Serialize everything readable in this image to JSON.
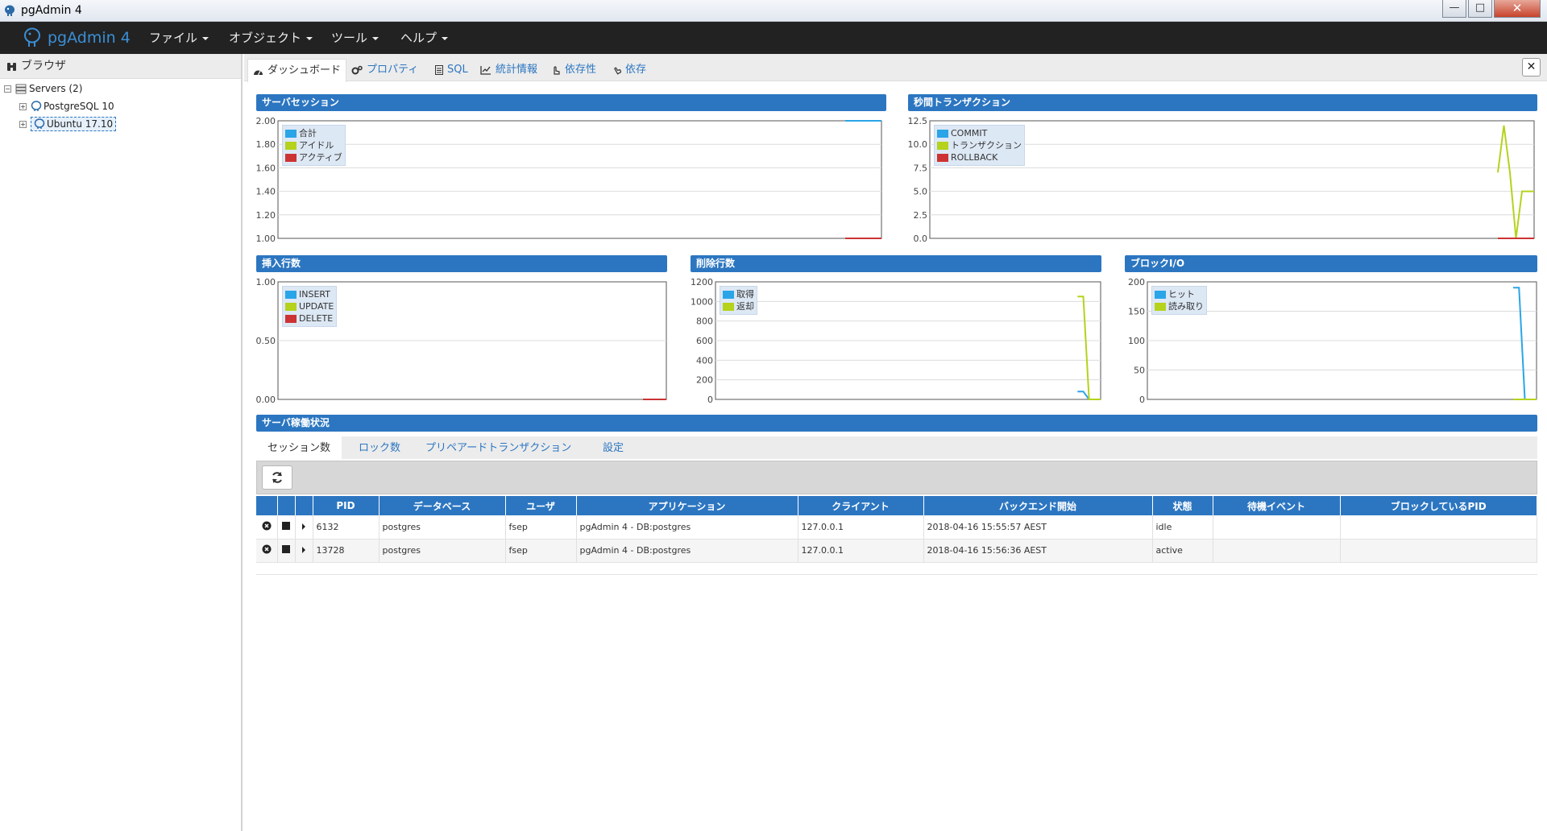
{
  "window": {
    "title": "pgAdmin 4",
    "controls": {
      "minimize": "—",
      "maximize": "□",
      "close": "✕"
    }
  },
  "appbar": {
    "brand": "pgAdmin 4",
    "menus": [
      "ファイル",
      "オブジェクト",
      "ツール",
      "ヘルプ"
    ]
  },
  "browser": {
    "title": "ブラウザ",
    "tree": {
      "servers_label": "Servers (2)",
      "children": [
        "PostgreSQL 10",
        "Ubuntu 17.10"
      ]
    }
  },
  "tabs": [
    "ダッシュボード",
    "プロパティ",
    "SQL",
    "統計情報",
    "依存性",
    "依存"
  ],
  "panels": {
    "server_sessions": "サーバセッション",
    "tps": "秒間トランザクション",
    "tuples_in": "挿入行数",
    "tuples_out": "削除行数",
    "block_io": "ブロックI/O",
    "server_activity": "サーバ稼働状況"
  },
  "chart_data": [
    {
      "type": "line",
      "title": "サーバセッション",
      "ylim": [
        1.0,
        2.0
      ],
      "yticks": [
        "2.00",
        "1.80",
        "1.60",
        "1.40",
        "1.20",
        "1.00"
      ],
      "legend_placement": "top-left",
      "grid": true,
      "series": [
        {
          "name": "合計",
          "color": "#2aa5e8",
          "values": [
            2,
            2,
            2,
            2,
            2,
            2,
            2,
            2
          ]
        },
        {
          "name": "アイドル",
          "color": "#b5d21c",
          "values": [
            1,
            1,
            1,
            1,
            1,
            1,
            1,
            1
          ]
        },
        {
          "name": "アクティブ",
          "color": "#cc3333",
          "values": [
            1,
            1,
            1,
            1,
            1,
            1,
            1,
            1
          ]
        }
      ]
    },
    {
      "type": "line",
      "title": "秒間トランザクション",
      "ylim": [
        0,
        12.5
      ],
      "yticks": [
        "12.5",
        "10.0",
        "7.5",
        "5.0",
        "2.5",
        "0.0"
      ],
      "legend_placement": "top-left",
      "grid": true,
      "series": [
        {
          "name": "COMMIT",
          "color": "#2aa5e8",
          "values": [
            0,
            0,
            0,
            0,
            0,
            0,
            0
          ]
        },
        {
          "name": "トランザクション",
          "color": "#b5d21c",
          "values": [
            7,
            12,
            7,
            0,
            5,
            5,
            5
          ]
        },
        {
          "name": "ROLLBACK",
          "color": "#cc3333",
          "values": [
            0,
            0,
            0,
            0,
            0,
            0,
            0
          ]
        }
      ]
    },
    {
      "type": "line",
      "title": "挿入行数",
      "ylim": [
        0,
        1.0
      ],
      "yticks": [
        "1.00",
        "0.50",
        "0.00"
      ],
      "legend_placement": "top-left",
      "grid": true,
      "series": [
        {
          "name": "INSERT",
          "color": "#2aa5e8",
          "values": [
            0,
            0,
            0,
            0
          ]
        },
        {
          "name": "UPDATE",
          "color": "#b5d21c",
          "values": [
            0,
            0,
            0,
            0
          ]
        },
        {
          "name": "DELETE",
          "color": "#cc3333",
          "values": [
            0,
            0,
            0,
            0
          ]
        }
      ]
    },
    {
      "type": "line",
      "title": "削除行数",
      "ylim": [
        0,
        1200
      ],
      "yticks": [
        "1200",
        "1000",
        "800",
        "600",
        "400",
        "200",
        "0"
      ],
      "legend_placement": "top-left",
      "grid": true,
      "series": [
        {
          "name": "取得",
          "color": "#2aa5e8",
          "values": [
            80,
            80,
            0,
            0,
            0
          ]
        },
        {
          "name": "返却",
          "color": "#b5d21c",
          "values": [
            1050,
            1050,
            0,
            0,
            0
          ]
        }
      ]
    },
    {
      "type": "line",
      "title": "ブロックI/O",
      "ylim": [
        0,
        200
      ],
      "yticks": [
        "200",
        "150",
        "100",
        "50",
        "0"
      ],
      "legend_placement": "top-left",
      "grid": true,
      "series": [
        {
          "name": "ヒット",
          "color": "#2aa5e8",
          "values": [
            190,
            190,
            0,
            0,
            0
          ]
        },
        {
          "name": "読み取り",
          "color": "#b5d21c",
          "values": [
            0,
            0,
            0,
            0,
            0
          ]
        }
      ]
    }
  ],
  "activity": {
    "subtabs": [
      "セッション数",
      "ロック数",
      "プリペアードトランザクション",
      "設定"
    ],
    "columns": [
      "PID",
      "データベース",
      "ユーザ",
      "アプリケーション",
      "クライアント",
      "バックエンド開始",
      "状態",
      "待機イベント",
      "ブロックしているPID"
    ],
    "rows": [
      {
        "pid": "6132",
        "db": "postgres",
        "user": "fsep",
        "app": "pgAdmin 4 - DB:postgres",
        "client": "127.0.0.1",
        "start": "2018-04-16 15:55:57 AEST",
        "state": "idle",
        "wait": "",
        "blocking": ""
      },
      {
        "pid": "13728",
        "db": "postgres",
        "user": "fsep",
        "app": "pgAdmin 4 - DB:postgres",
        "client": "127.0.0.1",
        "start": "2018-04-16 15:56:36 AEST",
        "state": "active",
        "wait": "",
        "blocking": ""
      }
    ]
  },
  "colors": {
    "accent": "#2c76c1",
    "appbar": "#222222"
  }
}
